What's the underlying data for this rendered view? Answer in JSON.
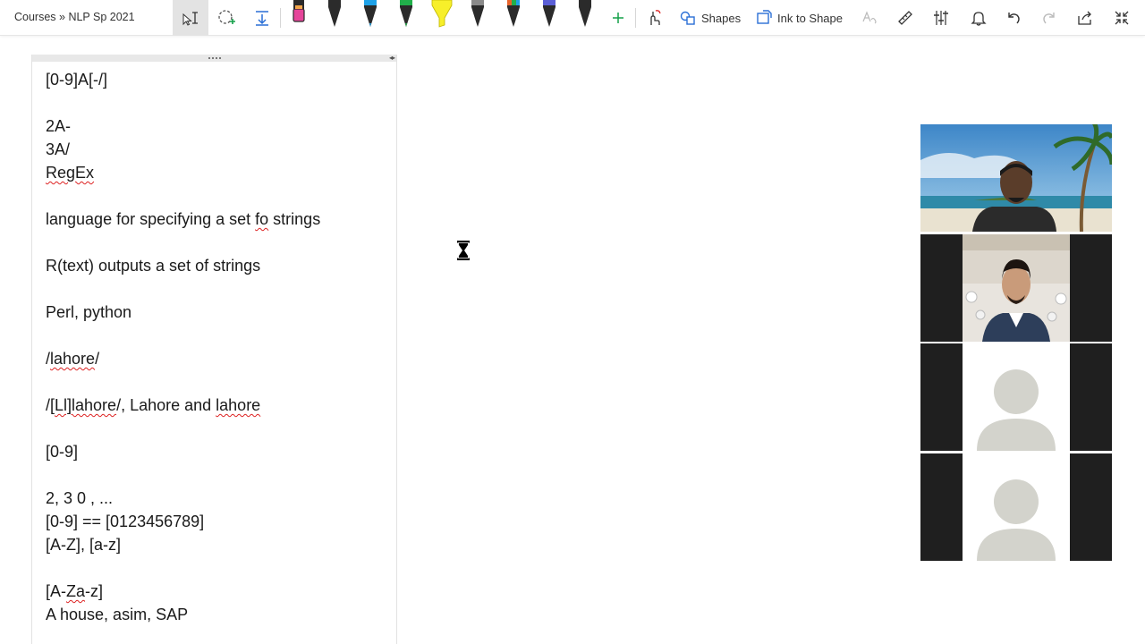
{
  "toolbar": {
    "breadcrumb": "Courses » NLP Sp 2021",
    "shapes_label": "Shapes",
    "ink_to_shape_label": "Ink to Shape",
    "pen_colors": [
      "#e6459a",
      "#2b2b2b",
      "#1fa2e8",
      "#21b04b",
      "#f7ef2a",
      "#7a7a7a",
      "#e8632b",
      "#5b5fd6",
      "#2b2b2b"
    ]
  },
  "note": {
    "lines": [
      {
        "text": "[0-9]A[-/]"
      },
      {
        "text": ""
      },
      {
        "text": "2A-"
      },
      {
        "text": "3A/"
      },
      {
        "segments": [
          {
            "t": "RegEx",
            "sq": true
          }
        ]
      },
      {
        "text": ""
      },
      {
        "segments": [
          {
            "t": "language for specifying a set ",
            "sq": false
          },
          {
            "t": "fo",
            "sq": true
          },
          {
            "t": " strings",
            "sq": false
          }
        ]
      },
      {
        "text": ""
      },
      {
        "text": "R(text) outputs a set of strings"
      },
      {
        "text": ""
      },
      {
        "text": "Perl, python"
      },
      {
        "text": ""
      },
      {
        "segments": [
          {
            "t": "/",
            "sq": false
          },
          {
            "t": "lahore",
            "sq": true
          },
          {
            "t": "/",
            "sq": false
          }
        ]
      },
      {
        "text": ""
      },
      {
        "segments": [
          {
            "t": "/[",
            "sq": false
          },
          {
            "t": "Ll]lahore",
            "sq": true
          },
          {
            "t": "/, Lahore and ",
            "sq": false
          },
          {
            "t": "lahore",
            "sq": true
          }
        ]
      },
      {
        "text": ""
      },
      {
        "text": "[0-9]"
      },
      {
        "text": ""
      },
      {
        "text": "2, 3 0 , ..."
      },
      {
        "text": "[0-9] == [0123456789]"
      },
      {
        "text": "[A-Z], [a-z]"
      },
      {
        "text": ""
      },
      {
        "segments": [
          {
            "t": "[A-",
            "sq": false
          },
          {
            "t": "Za",
            "sq": true
          },
          {
            "t": "-z]",
            "sq": false
          }
        ]
      },
      {
        "text": "A house, asim, SAP"
      }
    ]
  },
  "participants": [
    {
      "type": "video-beach",
      "bg": "#5fa0c8"
    },
    {
      "type": "video-indoor",
      "bg": "#1f1f1f"
    },
    {
      "type": "avatar",
      "bg": "#1f1f1f"
    },
    {
      "type": "avatar",
      "bg": "#1f1f1f"
    }
  ]
}
